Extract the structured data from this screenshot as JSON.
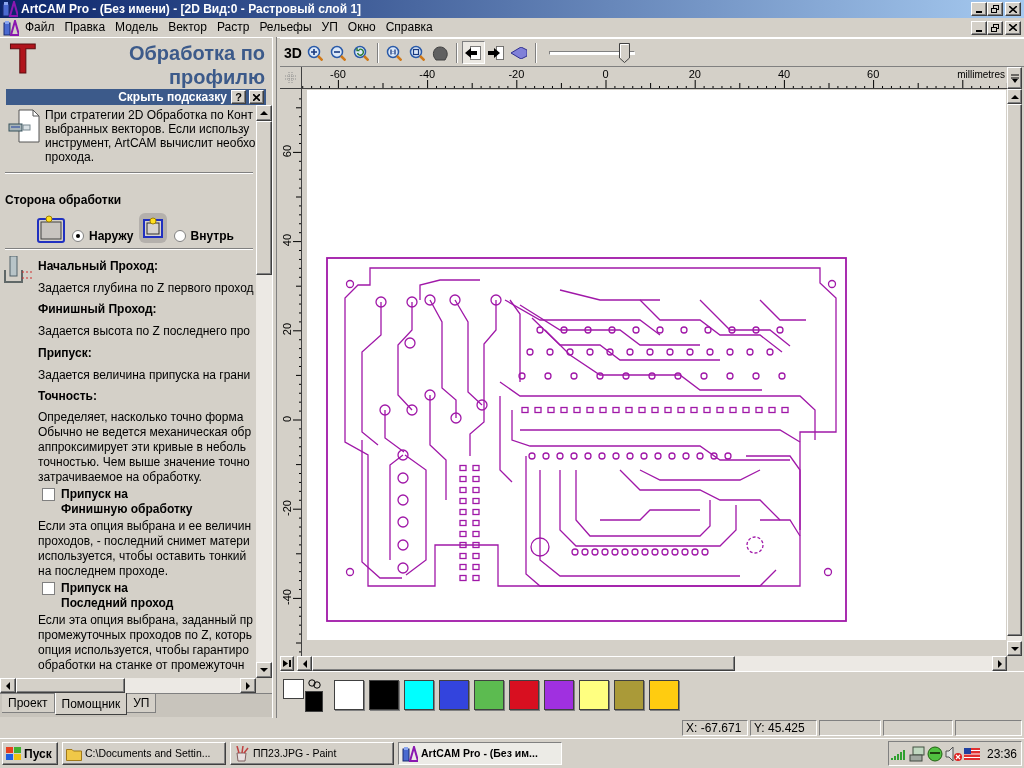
{
  "window": {
    "title": "ArtCAM Pro - (Без имени) - [2D Вид:0 - Растровый слой 1]"
  },
  "menu": [
    "Файл",
    "Правка",
    "Модель",
    "Вектор",
    "Растр",
    "Рельефы",
    "УП",
    "Окно",
    "Справка"
  ],
  "assistant": {
    "logo": "T",
    "title": "Обработка по профилю",
    "hint_bar": {
      "label": "Скрыть подсказку",
      "help": "?"
    },
    "intro_lines": [
      "При стратегии 2D Обработка по Конт",
      "выбранных векторов. Если использу",
      "инструмент, ArtCAM вычислит необхо",
      "прохода."
    ],
    "side": {
      "label": "Сторона обработки",
      "options": [
        {
          "kind": "outside",
          "label": "Наружу",
          "selected": true
        },
        {
          "kind": "inside",
          "label": "Внутрь",
          "selected": false
        }
      ]
    },
    "items": [
      {
        "kind": "heading",
        "text": "Начальный Проход:"
      },
      {
        "kind": "note",
        "text": "Задается глубина по Z первого проход"
      },
      {
        "kind": "heading",
        "text": "Финишный Проход:"
      },
      {
        "kind": "note",
        "text": "Задается высота по Z последнего про"
      },
      {
        "kind": "heading",
        "text": "Припуск:"
      },
      {
        "kind": "note",
        "text": "Задается величина припуска на грани"
      },
      {
        "kind": "heading",
        "text": "Точность:"
      },
      {
        "kind": "paragraph",
        "lines": [
          "Определяет, насколько точно форма",
          "Обычно не ведется механическая обр",
          "аппроксимирует эти кривые в неболь",
          "точностью. Чем выше значение точно",
          "затрачиваемое на обработку."
        ]
      },
      {
        "kind": "checkbox",
        "lines": [
          "Припуск на",
          "Финишную обработку"
        ],
        "checked": false
      },
      {
        "kind": "paragraph",
        "lines": [
          "Если эта опция выбрана и ее величин",
          "проходов, - последний снимет матери",
          "используется, чтобы оставить тонкий",
          "на последнем проходе."
        ]
      },
      {
        "kind": "checkbox",
        "lines": [
          "Припуск на",
          "Последний проход"
        ],
        "checked": false
      },
      {
        "kind": "paragraph",
        "lines": [
          "Если эта опция выбрана, заданный пр",
          "промежуточных проходов по Z, которь",
          "опция используется, чтобы гарантиро",
          "обработки на станке от промежуточн"
        ]
      }
    ],
    "tabs": [
      {
        "label": "Проект",
        "selected": false
      },
      {
        "label": "Помощник",
        "selected": true
      },
      {
        "label": "УП",
        "selected": false
      }
    ]
  },
  "toolbar": {
    "view_3d": "3D",
    "tools": [
      {
        "pressed": false
      },
      {
        "pressed": false
      },
      {
        "pressed": false
      },
      {
        "pressed": false
      },
      {
        "pressed": false
      },
      {
        "pressed": false
      },
      {
        "pressed": true
      },
      {
        "pressed": false
      },
      {
        "pressed": false
      }
    ],
    "zoom_slider": {
      "level": 0.93
    }
  },
  "rulers": {
    "x_labels": [
      "-60",
      "-40",
      "-20",
      "0",
      "20",
      "40",
      "60"
    ],
    "unit": "millimetres",
    "y_labels": [
      "60",
      "40",
      "20",
      "0",
      "-20",
      "-40"
    ]
  },
  "palette": {
    "current_colors": [
      {
        "color": "#ffffff"
      },
      {
        "color": "#000000"
      }
    ],
    "colors": [
      {
        "color": "#ffffff"
      },
      {
        "color": "#000000"
      },
      {
        "color": "#00ffff"
      },
      {
        "color": "#3344dd"
      },
      {
        "color": "#5cbb50"
      },
      {
        "color": "#d80f20"
      },
      {
        "color": "#a030e0"
      },
      {
        "color": "#ffff80"
      },
      {
        "color": "#aa9a38"
      },
      {
        "color": "#ffcc10"
      }
    ]
  },
  "status_bar": {
    "fields": [
      "X: -67.671",
      "Y: 45.425"
    ]
  },
  "taskbar": {
    "start": "Пуск",
    "tasks": [
      {
        "label": "C:\\Documents and Settin...",
        "selected": false
      },
      {
        "label": "ПП23.JPG - Paint",
        "selected": false
      },
      {
        "label": "ArtCAM Pro - (Без им...",
        "selected": true
      }
    ],
    "clock": "23:36"
  }
}
